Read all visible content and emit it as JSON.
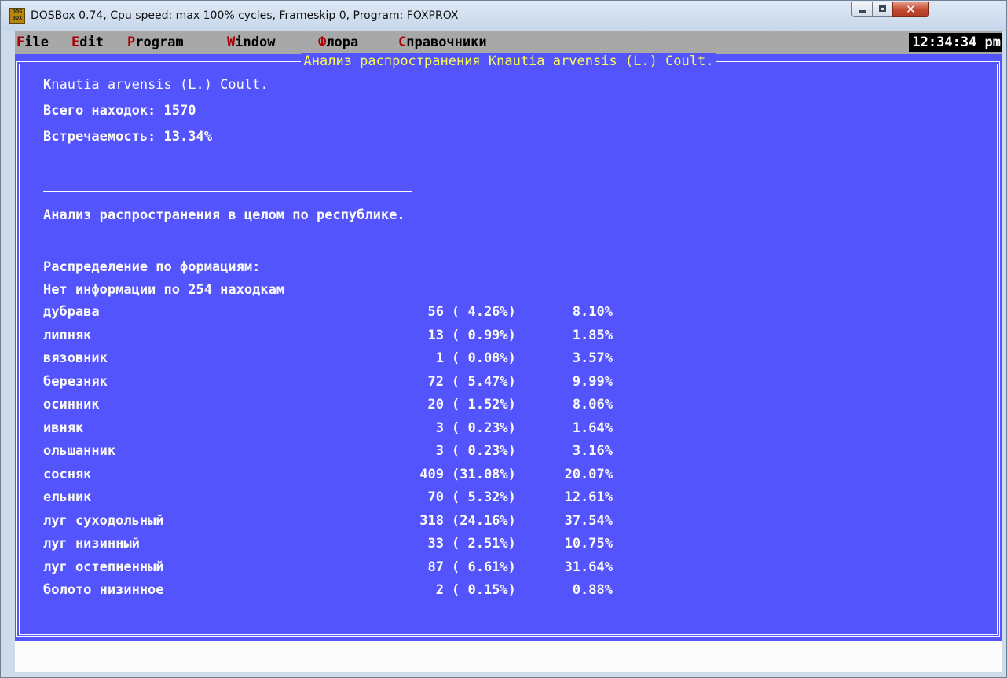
{
  "window": {
    "title": "DOSBox 0.74, Cpu speed: max 100% cycles, Frameskip  0, Program:  FOXPROX",
    "icon_label_top": "DOS",
    "icon_label_bottom": "BOX"
  },
  "menubar": {
    "items": [
      {
        "hot": "F",
        "rest": "ile"
      },
      {
        "hot": "E",
        "rest": "dit"
      },
      {
        "hot": "P",
        "rest": "rogram"
      },
      {
        "hot": "W",
        "rest": "indow"
      },
      {
        "hot": "Ф",
        "rest": "лора"
      },
      {
        "hot": "С",
        "rest": "правочники"
      }
    ],
    "clock": "12:34:34 pm"
  },
  "panel": {
    "title": "Анализ распространения Knautia arvensis (L.) Coult.",
    "species_hot": "K",
    "species_rest": "nautia arvensis (L.) Coult.",
    "total_finds": "Всего находок: 1570",
    "frequency": "Встречаемость: 13.34%",
    "analysis_heading": "Анализ распространения в целом по республике.",
    "distribution_heading": "Распределение по формациям:",
    "no_info": "Нет информации по 254 находкам"
  },
  "formations": [
    {
      "name": "дубрава",
      "count": "56",
      "pct": "( 4.26%)",
      "rel": "8.10%"
    },
    {
      "name": "липняк",
      "count": "13",
      "pct": "( 0.99%)",
      "rel": "1.85%"
    },
    {
      "name": "вязовник",
      "count": "1",
      "pct": "( 0.08%)",
      "rel": "3.57%"
    },
    {
      "name": "березняк",
      "count": "72",
      "pct": "( 5.47%)",
      "rel": "9.99%"
    },
    {
      "name": "осинник",
      "count": "20",
      "pct": "( 1.52%)",
      "rel": "8.06%"
    },
    {
      "name": "ивняк",
      "count": "3",
      "pct": "( 0.23%)",
      "rel": "1.64%"
    },
    {
      "name": "ольшанник",
      "count": "3",
      "pct": "( 0.23%)",
      "rel": "3.16%"
    },
    {
      "name": "сосняк",
      "count": "409",
      "pct": "(31.08%)",
      "rel": "20.07%"
    },
    {
      "name": "ельник",
      "count": "70",
      "pct": "( 5.32%)",
      "rel": "12.61%"
    },
    {
      "name": "луг суходольный",
      "count": "318",
      "pct": "(24.16%)",
      "rel": "37.54%"
    },
    {
      "name": "луг низинный",
      "count": "33",
      "pct": "( 2.51%)",
      "rel": "10.75%"
    },
    {
      "name": "луг остепненный",
      "count": "87",
      "pct": "( 6.61%)",
      "rel": "31.64%"
    },
    {
      "name": "болото низинное",
      "count": "2",
      "pct": "( 0.15%)",
      "rel": "0.88%"
    }
  ],
  "colors": {
    "background": "#5454fc",
    "text": "#fcfcfc",
    "title": "#fcfc54",
    "menu_bg": "#a8a8a8",
    "hotkey": "#a80000"
  }
}
